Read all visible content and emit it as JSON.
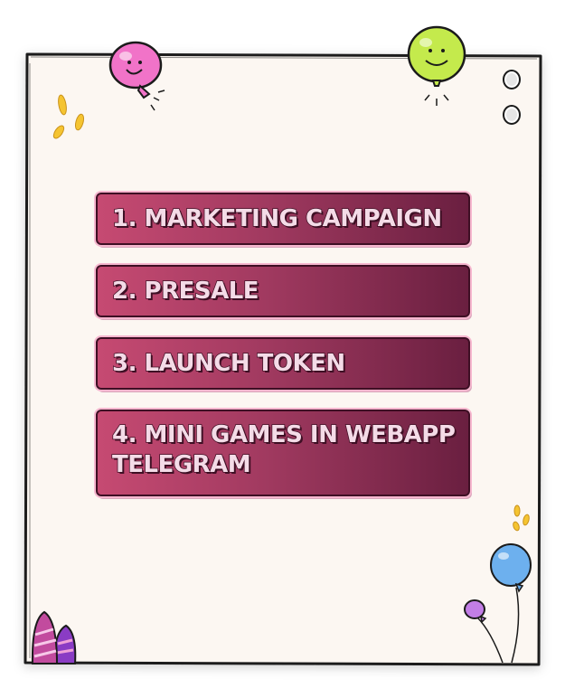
{
  "roadmap": {
    "steps": [
      {
        "label": "1. MARKETING CAMPAIGN"
      },
      {
        "label": "2. PRESALE"
      },
      {
        "label": "3. LAUNCH TOKEN"
      },
      {
        "label": "4. MINI GAMES IN WEBAPP TELEGRAM"
      }
    ]
  },
  "colors": {
    "paper": "#fcf7f2",
    "button_start": "#c64a72",
    "button_end": "#6a1f40",
    "button_text": "#f4dbe7",
    "outline": "#3e0f24"
  },
  "icons": [
    "pink-balloon-icon",
    "green-balloon-icon",
    "blue-balloon-icon",
    "purple-balloon-icon",
    "binder-hole-icon",
    "coin-confetti-icon",
    "easter-egg-icon"
  ]
}
